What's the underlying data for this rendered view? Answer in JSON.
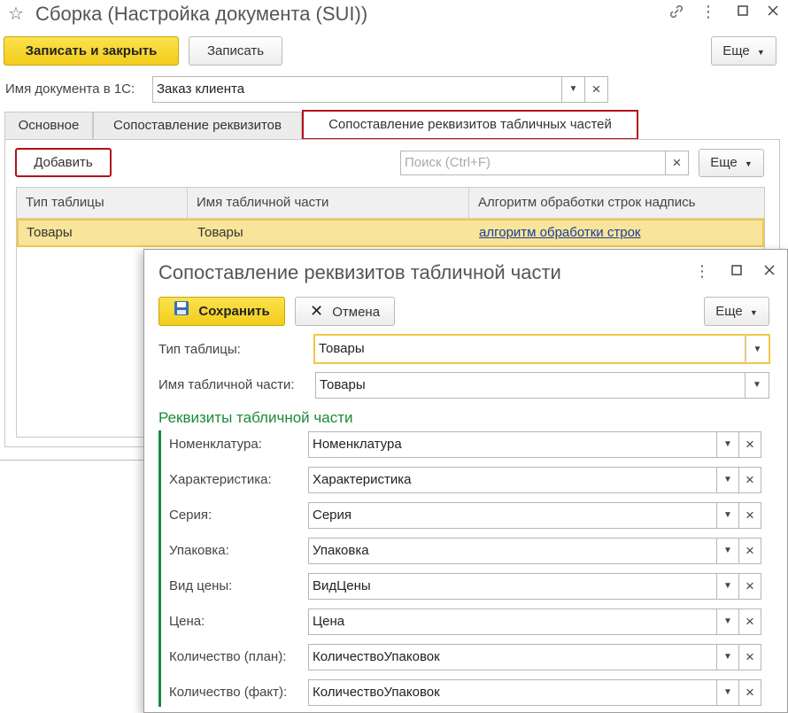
{
  "window": {
    "title": "Сборка (Настройка документа (SUI))",
    "header_icons": [
      "star-icon",
      "link-icon",
      "more-vert-icon",
      "maximize-icon",
      "close-icon"
    ]
  },
  "toolbar": {
    "write_close_label": "Записать и закрыть",
    "write_label": "Записать",
    "more_label": "Еще"
  },
  "doc_name": {
    "label": "Имя документа в 1С:",
    "value": "Заказ клиента"
  },
  "tabs": [
    {
      "label": "Основное",
      "active": false
    },
    {
      "label": "Сопоставление реквизитов",
      "active": false
    },
    {
      "label": "Сопоставление реквизитов табличных частей",
      "active": true
    }
  ],
  "table_toolbar": {
    "add_label": "Добавить",
    "search_placeholder": "Поиск (Ctrl+F)",
    "more_label": "Еще"
  },
  "grid": {
    "columns": [
      "Тип таблицы",
      "Имя табличной части",
      "Алгоритм обработки строк надпись"
    ],
    "rows": [
      {
        "type": "Товары",
        "name": "Товары",
        "algo": "алгоритм обработки строк"
      }
    ]
  },
  "dialog": {
    "title": "Сопоставление реквизитов табличной части",
    "save_label": "Сохранить",
    "cancel_label": "Отмена",
    "more_label": "Еще",
    "table_type": {
      "label": "Тип таблицы:",
      "value": "Товары"
    },
    "part_name": {
      "label": "Имя табличной части:",
      "value": "Товары"
    },
    "section_title": "Реквизиты табличной части",
    "fields": [
      {
        "label": "Номенклатура:",
        "value": "Номенклатура"
      },
      {
        "label": "Характеристика:",
        "value": "Характеристика"
      },
      {
        "label": "Серия:",
        "value": "Серия"
      },
      {
        "label": "Упаковка:",
        "value": "Упаковка"
      },
      {
        "label": "Вид цены:",
        "value": "ВидЦены"
      },
      {
        "label": "Цена:",
        "value": "Цена"
      },
      {
        "label": "Количество (план):",
        "value": "КоличествоУпаковок"
      },
      {
        "label": "Количество (факт):",
        "value": "КоличествоУпаковок"
      }
    ]
  },
  "colors": {
    "accent_yellow": "#f5d22a",
    "active_tab_border": "#b3101a",
    "section_green": "#1a8a3a",
    "link_blue": "#1a3d9c",
    "selected_row": "#f8e49a"
  }
}
